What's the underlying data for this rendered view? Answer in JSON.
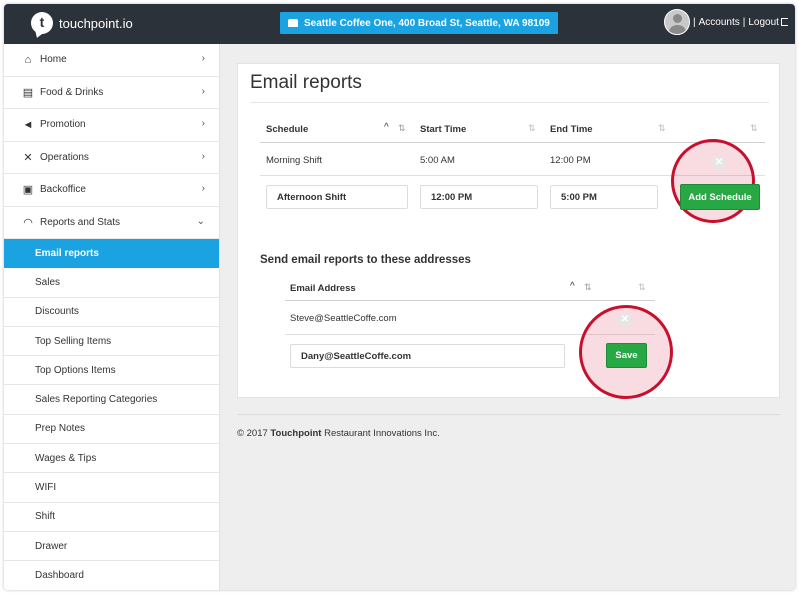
{
  "app": {
    "logo_text": "touchpoint.io",
    "logo_letter": "t"
  },
  "header": {
    "location": "Seattle Coffee One, 400 Broad St, Seattle, WA 98109",
    "accounts_label": "Accounts",
    "logout_label": "Logout",
    "separator": "|"
  },
  "sidebar": {
    "items": [
      {
        "label": "Home",
        "icon": "home-icon"
      },
      {
        "label": "Food & Drinks",
        "icon": "book-icon"
      },
      {
        "label": "Promotion",
        "icon": "megaphone-icon"
      },
      {
        "label": "Operations",
        "icon": "tools-icon"
      },
      {
        "label": "Backoffice",
        "icon": "briefcase-icon"
      },
      {
        "label": "Reports and Stats",
        "icon": "gauge-icon"
      }
    ],
    "sub_items": [
      "Email reports",
      "Sales",
      "Discounts",
      "Top Selling Items",
      "Top Options Items",
      "Sales Reporting Categories",
      "Prep Notes",
      "Wages & Tips",
      "WIFI",
      "Shift",
      "Drawer",
      "Dashboard"
    ],
    "active_sub_item": "Email reports"
  },
  "main": {
    "title": "Email reports",
    "schedule_table": {
      "headers": [
        "Schedule",
        "Start Time",
        "End Time"
      ],
      "rows": [
        {
          "schedule": "Morning Shift",
          "start": "5:00 AM",
          "end": "12:00 PM"
        }
      ],
      "new_row": {
        "schedule": "Afternoon Shift",
        "start": "12:00 PM",
        "end": "5:00 PM"
      },
      "add_button": "Add Schedule"
    },
    "email_section": {
      "title": "Send email reports to these addresses",
      "header": "Email Address",
      "rows": [
        "Steve@SeattleCoffe.com"
      ],
      "new_email": "Dany@SeattleCoffe.com",
      "save_button": "Save"
    }
  },
  "footer": {
    "prefix": "© 2017 ",
    "brand": "Touchpoint",
    "suffix": " Restaurant Innovations Inc."
  },
  "colors": {
    "topbar": "#2c323a",
    "accent": "#1aa3e0",
    "button": "#28a745",
    "highlight_ring": "#c8102e"
  }
}
